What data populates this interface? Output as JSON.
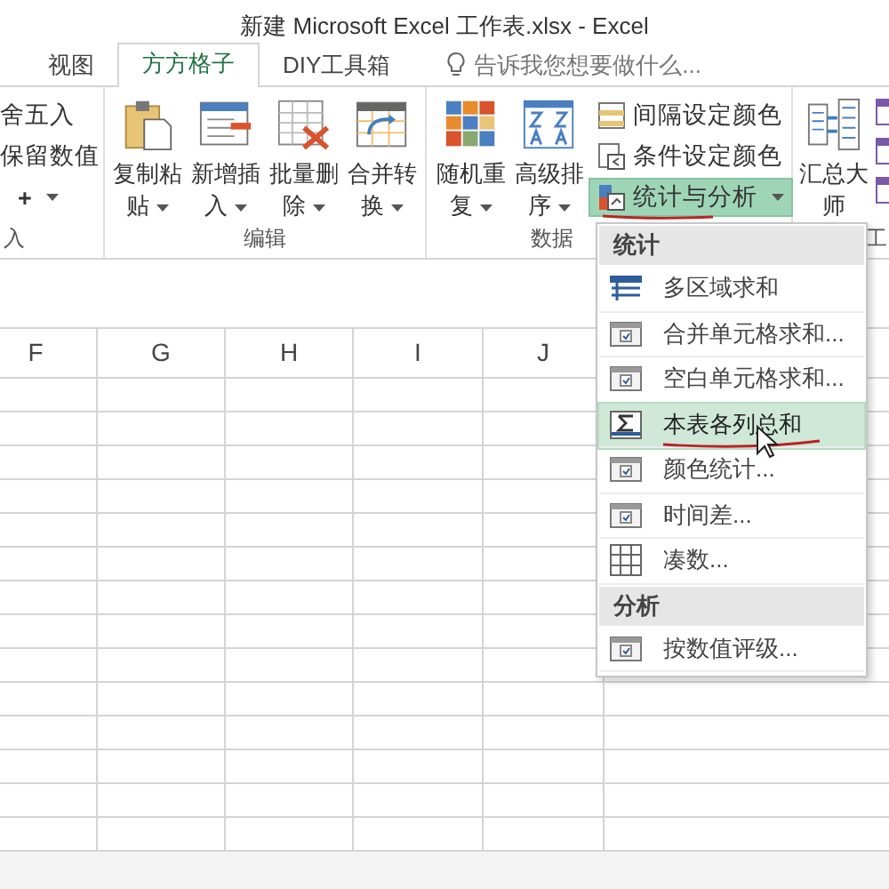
{
  "window": {
    "title": "新建 Microsoft Excel 工作表.xlsx - Excel"
  },
  "tabs": [
    {
      "label": "视图",
      "selected": false
    },
    {
      "label": "方方格子",
      "selected": true
    },
    {
      "label": "DIY工具箱",
      "selected": false
    }
  ],
  "tell_me": {
    "placeholder": "告诉我您想要做什么..."
  },
  "ribbon_groups": [
    {
      "label": "入",
      "items": [
        {
          "kind": "small",
          "label": "舍五入",
          "dropdown": false,
          "pressed": false
        },
        {
          "kind": "small",
          "label": "保留数值",
          "dropdown": false,
          "pressed": false
        },
        {
          "kind": "small",
          "label": "+",
          "dropdown": true,
          "pressed": false
        }
      ]
    },
    {
      "label": "编辑",
      "items": [
        {
          "kind": "large",
          "label": "复制粘贴",
          "dropdown": true,
          "pressed": false
        },
        {
          "kind": "large",
          "label": "新增插入",
          "dropdown": true,
          "pressed": false
        },
        {
          "kind": "large",
          "label": "批量删除",
          "dropdown": true,
          "pressed": false
        },
        {
          "kind": "large",
          "label": "合并转换",
          "dropdown": true,
          "pressed": false
        }
      ]
    },
    {
      "label": "数据",
      "items": [
        {
          "kind": "large",
          "label": "随机重复",
          "dropdown": true,
          "pressed": false
        },
        {
          "kind": "large",
          "label": "高级排序",
          "dropdown": true,
          "pressed": false
        },
        {
          "kind": "small",
          "label": "间隔设定颜色",
          "dropdown": false,
          "pressed": false
        },
        {
          "kind": "small",
          "label": "条件设定颜色",
          "dropdown": false,
          "pressed": false
        },
        {
          "kind": "small",
          "label": "统计与分析",
          "dropdown": true,
          "pressed": true
        }
      ]
    },
    {
      "label": "工",
      "items": [
        {
          "kind": "large",
          "label": "汇总大师",
          "dropdown": false,
          "pressed": false
        },
        {
          "kind": "icon",
          "dropdown": false,
          "pressed": false
        },
        {
          "kind": "icon",
          "dropdown": false,
          "pressed": false
        },
        {
          "kind": "icon",
          "dropdown": false,
          "pressed": false
        }
      ]
    }
  ],
  "sheet": {
    "columns": [
      "F",
      "G",
      "H",
      "I",
      "J",
      ""
    ]
  },
  "menu": [
    {
      "kind": "header",
      "label": "统计"
    },
    {
      "kind": "item",
      "label": "多区域求和",
      "selected": false
    },
    {
      "kind": "item",
      "label": "合并单元格求和...",
      "selected": false
    },
    {
      "kind": "item",
      "label": "空白单元格求和...",
      "selected": false
    },
    {
      "kind": "item",
      "label": "本表各列总和",
      "selected": true
    },
    {
      "kind": "item",
      "label": "颜色统计...",
      "selected": false
    },
    {
      "kind": "item",
      "label": "时间差...",
      "selected": false
    },
    {
      "kind": "item",
      "label": "凑数...",
      "selected": false
    },
    {
      "kind": "header",
      "label": "分析"
    },
    {
      "kind": "item",
      "label": "按数值评级...",
      "selected": false
    }
  ]
}
